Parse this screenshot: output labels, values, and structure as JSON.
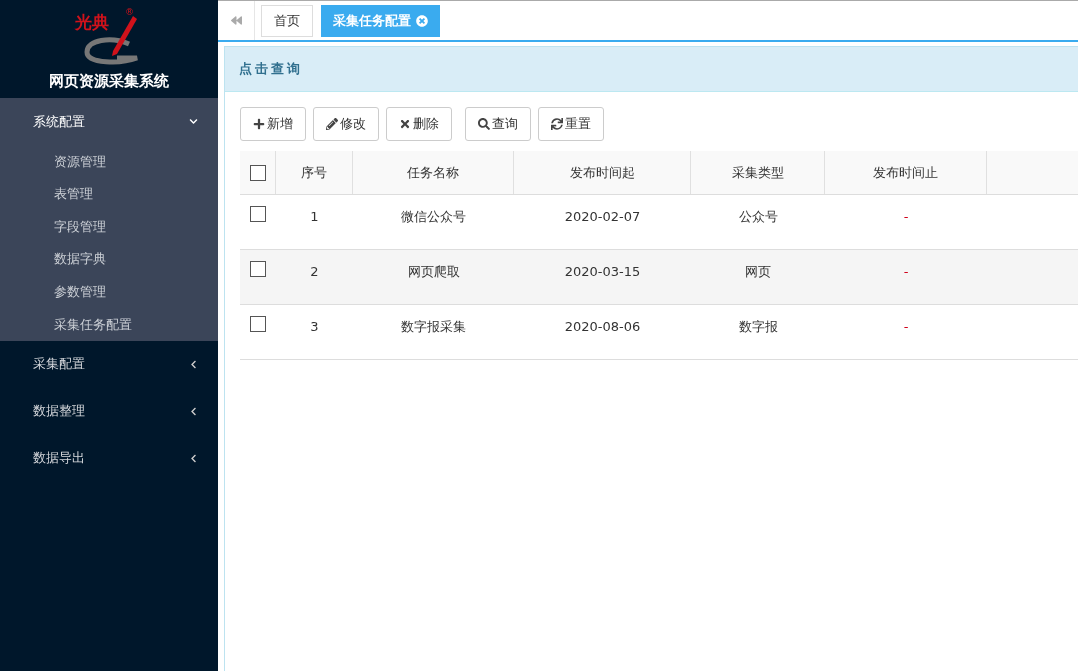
{
  "logo": {
    "mark_text": "光典",
    "registered": "®"
  },
  "app_title": "网页资源采集系统",
  "menu": [
    {
      "label": "系统配置",
      "expanded": true,
      "children": [
        {
          "label": "资源管理"
        },
        {
          "label": "表管理"
        },
        {
          "label": "字段管理"
        },
        {
          "label": "数据字典"
        },
        {
          "label": "参数管理"
        },
        {
          "label": "采集任务配置"
        }
      ]
    },
    {
      "label": "采集配置",
      "expanded": false
    },
    {
      "label": "数据整理",
      "expanded": false
    },
    {
      "label": "数据导出",
      "expanded": false
    }
  ],
  "tabs": [
    {
      "label": "首页",
      "selected": false,
      "closable": false
    },
    {
      "label": "采集任务配置",
      "selected": true,
      "closable": true
    }
  ],
  "panel_title": "点击查询",
  "toolbar": [
    {
      "label": "新增",
      "kind": "add"
    },
    {
      "label": "修改",
      "kind": "edit"
    },
    {
      "label": "删除",
      "kind": "delete"
    },
    {
      "label": "查询",
      "kind": "search"
    },
    {
      "label": "重置",
      "kind": "reset"
    }
  ],
  "table": {
    "header_checked": false,
    "columns": [
      "序号",
      "任务名称",
      "发布时间起",
      "采集类型",
      "发布时间止"
    ],
    "rows": [
      {
        "checked": false,
        "cells": [
          "1",
          "微信公众号",
          "2020-02-07",
          "公众号",
          "-"
        ]
      },
      {
        "checked": false,
        "cells": [
          "2",
          "网页爬取",
          "2020-03-15",
          "网页",
          "-"
        ]
      },
      {
        "checked": false,
        "cells": [
          "3",
          "数字报采集",
          "2020-08-06",
          "数字报",
          "-"
        ]
      }
    ]
  }
}
